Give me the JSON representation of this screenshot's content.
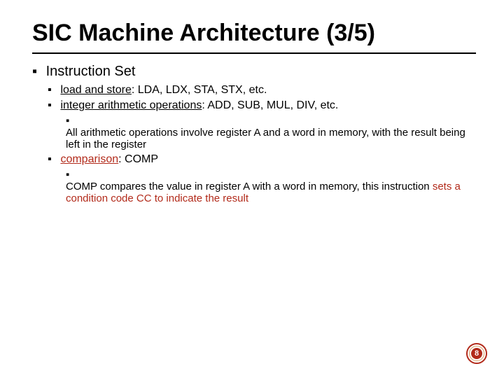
{
  "title": "SIC Machine Architecture (3/5)",
  "section": "Instruction Set",
  "items": {
    "load_store": {
      "label": "load and store",
      "rest": ": LDA, LDX, STA, STX, etc."
    },
    "int_arith": {
      "label": "integer arithmetic operations",
      "rest": ": ADD, SUB, MUL, DIV, etc.",
      "note": "All arithmetic operations involve register A and a word in memory, with the result being left in the register"
    },
    "comparison": {
      "label": "comparison",
      "rest": ": COMP",
      "note_prefix": "COMP compares the value in register A with a word in memory, this instruction ",
      "note_highlight": "sets a condition code CC to indicate the result"
    }
  },
  "bullets": {
    "square": "▪"
  },
  "page_number": "8"
}
